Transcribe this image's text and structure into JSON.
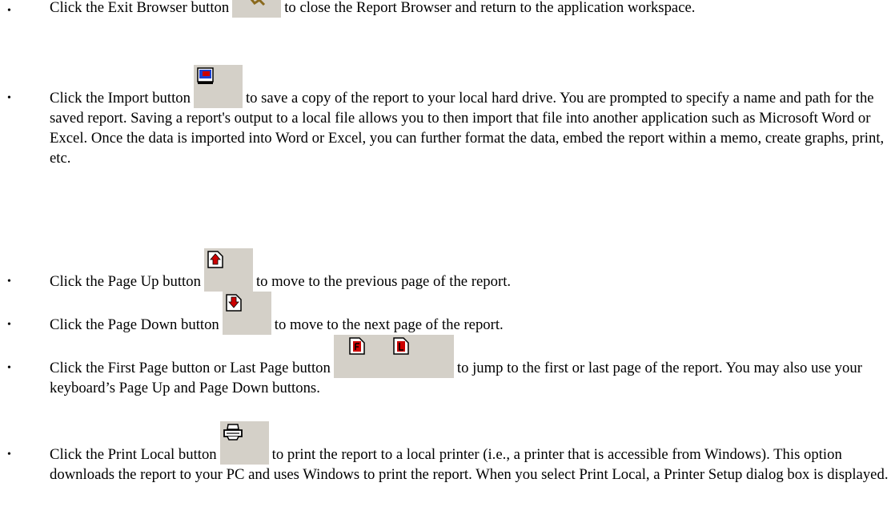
{
  "bullet_char": "•",
  "items": [
    {
      "before": "Click the Exit Browser button",
      "after": "to close the Report Browser and return to the application workspace.",
      "icon": "exit-browser-icon"
    },
    {
      "before": "Click the Import button",
      "after": "to save a copy of the report to your local hard drive. You are prompted to specify a name and path for the saved report.  Saving a report's output to a local file allows you to then import that file into another application such as Microsoft Word or Excel. Once the data is imported into Word or Excel, you can further format the data, embed the report within a memo, create graphs, print, etc.",
      "icon": "import-icon"
    },
    {
      "before": "Click the Page Up button",
      "after": "to move to the previous page of the report.",
      "icon": "page-up-icon"
    },
    {
      "before": "Click the Page Down button",
      "after": "to move to the next page of the report.",
      "icon": "page-down-icon"
    },
    {
      "before": "Click the First Page button or Last Page button",
      "after": "to jump to the first or last page of the report. You may also use your keyboard’s Page Up and Page Down buttons.",
      "icons": [
        "first-page-icon",
        "last-page-icon"
      ]
    },
    {
      "before": "Click the Print Local button",
      "after": "to print the report to a local printer (i.e., a printer that is accessible from Windows). This option downloads the report to your PC and uses Windows to print the report. When you select Print Local, a Printer Setup dialog box is displayed.",
      "icon": "print-local-icon"
    }
  ],
  "colors": {
    "button_bg": "#d4d0c8",
    "icon_red": "#cc0000",
    "icon_blue": "#1c3fd0"
  }
}
